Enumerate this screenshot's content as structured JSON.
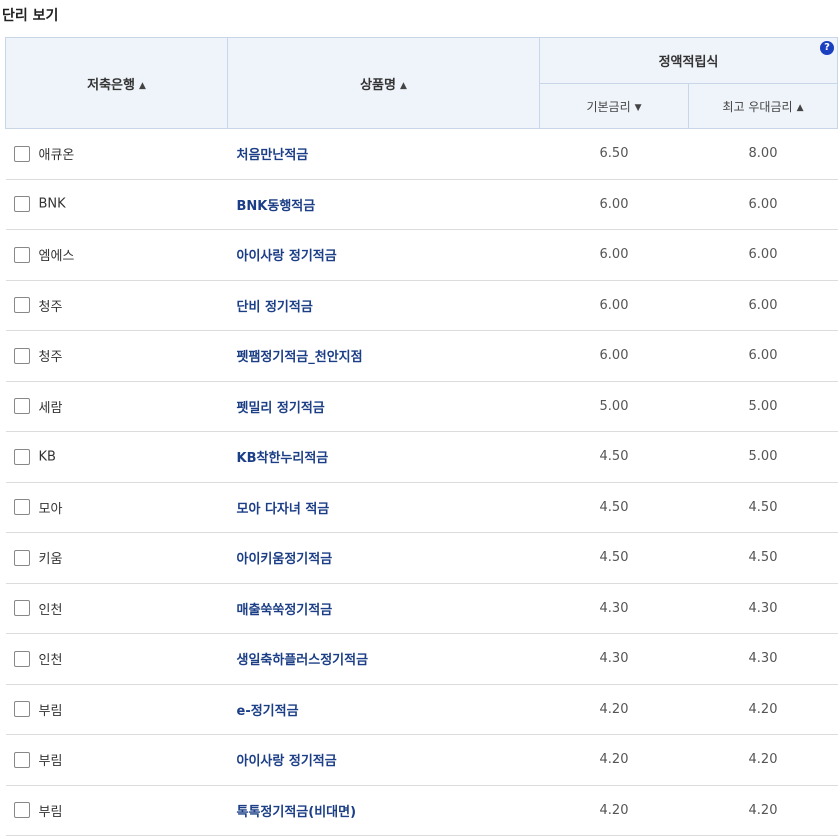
{
  "page_title": "단리 보기",
  "headers": {
    "bank": "저축은행",
    "product": "상품명",
    "group": "정액적립식",
    "base_rate": "기본금리",
    "max_rate": "최고 우대금리",
    "help_icon": "?",
    "sort_up": "▲",
    "sort_down": "▼"
  },
  "rows": [
    {
      "bank": "애큐온",
      "product": "처음만난적금",
      "base": "6.50",
      "max": "8.00"
    },
    {
      "bank": "BNK",
      "product": "BNK동행적금",
      "base": "6.00",
      "max": "6.00"
    },
    {
      "bank": "엠에스",
      "product": "아이사랑 정기적금",
      "base": "6.00",
      "max": "6.00"
    },
    {
      "bank": "청주",
      "product": "단비 정기적금",
      "base": "6.00",
      "max": "6.00"
    },
    {
      "bank": "청주",
      "product": "펫팸정기적금_천안지점",
      "base": "6.00",
      "max": "6.00"
    },
    {
      "bank": "세람",
      "product": "펫밀리 정기적금",
      "base": "5.00",
      "max": "5.00"
    },
    {
      "bank": "KB",
      "product": "KB착한누리적금",
      "base": "4.50",
      "max": "5.00"
    },
    {
      "bank": "모아",
      "product": "모아 다자녀 적금",
      "base": "4.50",
      "max": "4.50"
    },
    {
      "bank": "키움",
      "product": "아이키움정기적금",
      "base": "4.50",
      "max": "4.50"
    },
    {
      "bank": "인천",
      "product": "매출쑥쑥정기적금",
      "base": "4.30",
      "max": "4.30"
    },
    {
      "bank": "인천",
      "product": "생일축하플러스정기적금",
      "base": "4.30",
      "max": "4.30"
    },
    {
      "bank": "부림",
      "product": "e-정기적금",
      "base": "4.20",
      "max": "4.20"
    },
    {
      "bank": "부림",
      "product": "아이사랑 정기적금",
      "base": "4.20",
      "max": "4.20"
    },
    {
      "bank": "부림",
      "product": "톡톡정기적금(비대면)",
      "base": "4.20",
      "max": "4.20"
    }
  ]
}
